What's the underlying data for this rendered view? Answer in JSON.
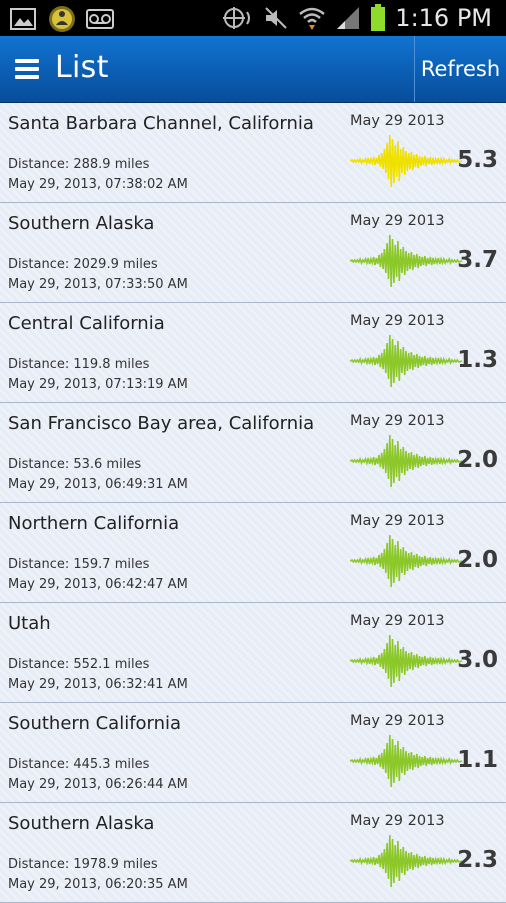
{
  "status": {
    "time": "1:16 PM",
    "icons": [
      "image-icon",
      "meditation-app-icon",
      "voicemail-icon",
      "location-icon",
      "mute-icon",
      "wifi-icon",
      "signal-icon",
      "battery-icon"
    ]
  },
  "header": {
    "title": "List",
    "refresh_label": "Refresh"
  },
  "colors": {
    "strong_wave": "#f0e000",
    "wave": "#8cc82a",
    "appbar": "#0a5cb0"
  },
  "quakes": [
    {
      "location": "Santa Barbara Channel, California",
      "distance": "Distance: 288.9 miles",
      "time": "May 29, 2013, 07:38:02 AM",
      "date": "May 29 2013",
      "magnitude": "5.3",
      "wave_color": "#f0e000"
    },
    {
      "location": "Southern Alaska",
      "distance": "Distance: 2029.9 miles",
      "time": "May 29, 2013, 07:33:50 AM",
      "date": "May 29 2013",
      "magnitude": "3.7",
      "wave_color": "#8cc82a"
    },
    {
      "location": "Central California",
      "distance": "Distance: 119.8 miles",
      "time": "May 29, 2013, 07:13:19 AM",
      "date": "May 29 2013",
      "magnitude": "1.3",
      "wave_color": "#8cc82a"
    },
    {
      "location": "San Francisco Bay area, California",
      "distance": "Distance: 53.6 miles",
      "time": "May 29, 2013, 06:49:31 AM",
      "date": "May 29 2013",
      "magnitude": "2.0",
      "wave_color": "#8cc82a"
    },
    {
      "location": "Northern California",
      "distance": "Distance: 159.7 miles",
      "time": "May 29, 2013, 06:42:47 AM",
      "date": "May 29 2013",
      "magnitude": "2.0",
      "wave_color": "#8cc82a"
    },
    {
      "location": "Utah",
      "distance": "Distance: 552.1 miles",
      "time": "May 29, 2013, 06:32:41 AM",
      "date": "May 29 2013",
      "magnitude": "3.0",
      "wave_color": "#8cc82a"
    },
    {
      "location": "Southern California",
      "distance": "Distance: 445.3 miles",
      "time": "May 29, 2013, 06:26:44 AM",
      "date": "May 29 2013",
      "magnitude": "1.1",
      "wave_color": "#8cc82a"
    },
    {
      "location": "Southern Alaska",
      "distance": "Distance: 1978.9 miles",
      "time": "May 29, 2013, 06:20:35 AM",
      "date": "May 29 2013",
      "magnitude": "2.3",
      "wave_color": "#8cc82a"
    }
  ]
}
